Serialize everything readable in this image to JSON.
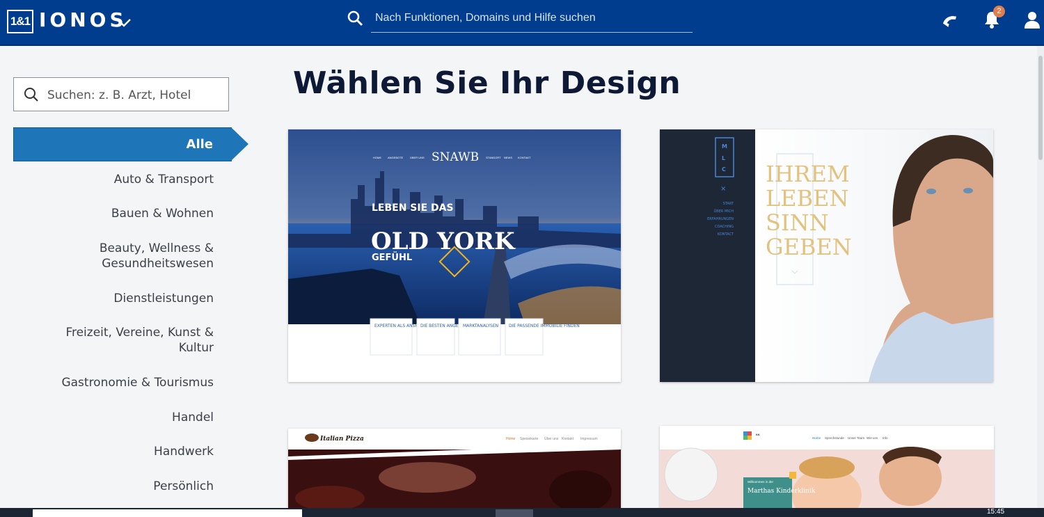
{
  "header": {
    "logo_mark": "1&1",
    "logo_text": "IONOS",
    "search_placeholder": "Nach Funktionen, Domains und Hilfe suchen",
    "notification_count": "2",
    "brand_color": "#003d8f"
  },
  "sidebar": {
    "search_placeholder": "Suchen: z. B. Arzt, Hotel",
    "active_category": "Alle",
    "categories": [
      "Auto & Transport",
      "Bauen & Wohnen",
      "Beauty, Wellness & Gesundheitswesen",
      "Dienstleistungen",
      "Freizeit, Vereine, Kunst & Kultur",
      "Gastronomie & Tourismus",
      "Handel",
      "Handwerk",
      "Persönlich"
    ]
  },
  "main": {
    "title": "Wählen Sie Ihr Design",
    "designs": [
      {
        "brand": "SNAWB",
        "nav": [
          "HOME",
          "ANGEBOTE",
          "ÜBER UNS",
          "STANDORT",
          "NEWS",
          "KONTAKT"
        ],
        "headline_small": "LEBEN SIE DAS",
        "headline_big": "OLD YORK",
        "headline_end": "GEFÜHL",
        "tiles": [
          "EXPERTEN ALS ANSPRECHPARTNER",
          "DIE BESTEN ANGEBOTE AM MARKT",
          "MARKTANALYSEN",
          "DIE PASSENDE IMMOBILIE FINDEN"
        ]
      },
      {
        "brand": "MLC",
        "close": "×",
        "nav": [
          "START",
          "ÜBER MICH",
          "ERFAHRUNGEN",
          "COACHING",
          "KONTACT"
        ],
        "headline": [
          "IHREM",
          "LEBEN",
          "SINN",
          "GEBEN"
        ]
      },
      {
        "brand": "Italian Pizza",
        "nav": [
          "Home",
          "Speisekarte",
          "Über uns",
          "Kontakt",
          "Impressum"
        ]
      },
      {
        "brand_small": "KK",
        "nav": [
          "Home",
          "Sprechstunde",
          "Unser Team",
          "Wie uns",
          "Info"
        ],
        "badge": "Willkommen in der",
        "title": "Marthas Kinderklinik"
      }
    ]
  },
  "taskbar": {
    "time": "15:45"
  }
}
